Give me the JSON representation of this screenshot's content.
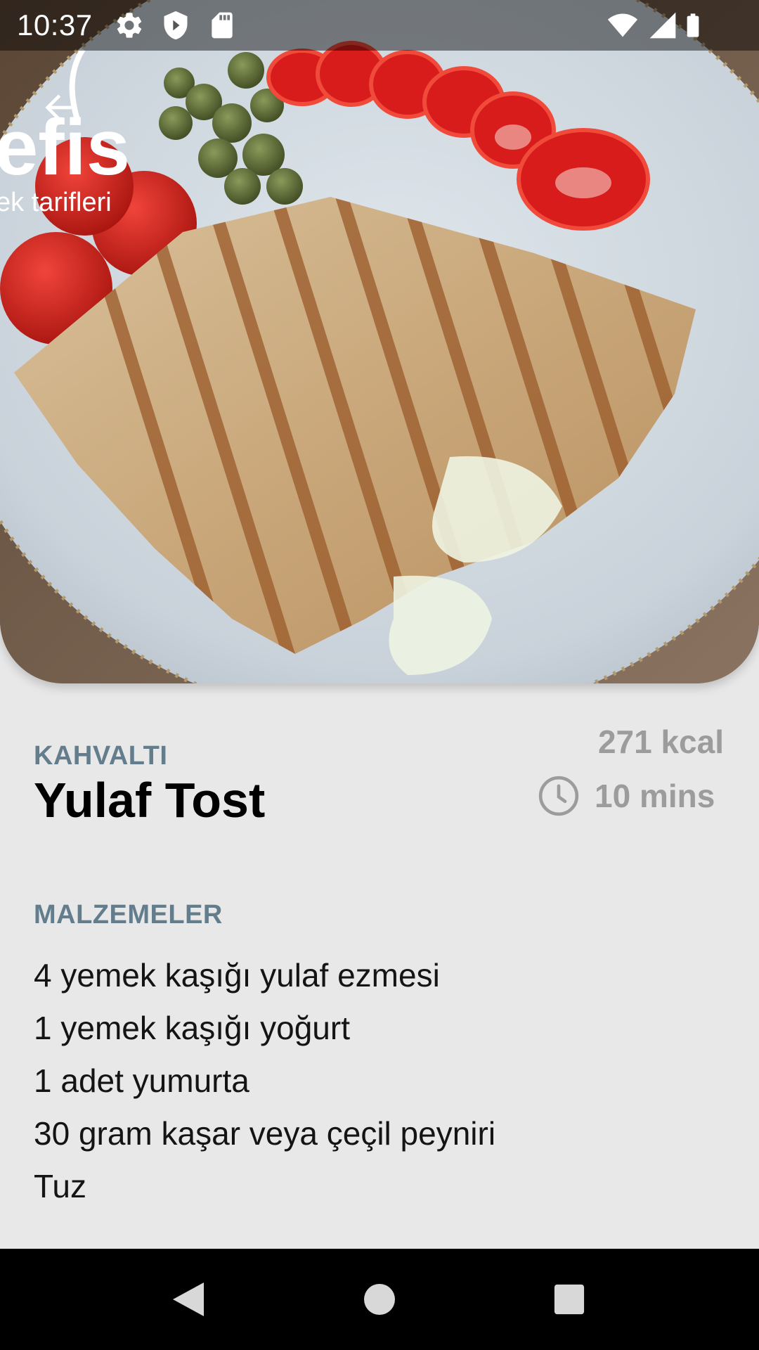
{
  "status_bar": {
    "time": "10:37",
    "icons": [
      "settings-icon",
      "shield-icon",
      "sd-card-icon",
      "wifi-icon",
      "signal-icon",
      "battery-icon"
    ]
  },
  "hero": {
    "watermark_brand": "efis",
    "watermark_sub": "ek tarifleri"
  },
  "recipe": {
    "category": "KAHVALTI",
    "title": "Yulaf Tost",
    "calories": "271 kcal",
    "time": "10 mins"
  },
  "ingredients_section": {
    "label": "MALZEMELER",
    "items": [
      "4 yemek kaşığı yulaf ezmesi",
      "1 yemek kaşığı yoğurt",
      "1 adet yumurta",
      "30 gram kaşar veya çeçil peyniri",
      "Tuz"
    ]
  },
  "colors": {
    "accent_label": "#637d8c",
    "muted_text": "#9c9c9c",
    "background": "#e8e8e8"
  }
}
